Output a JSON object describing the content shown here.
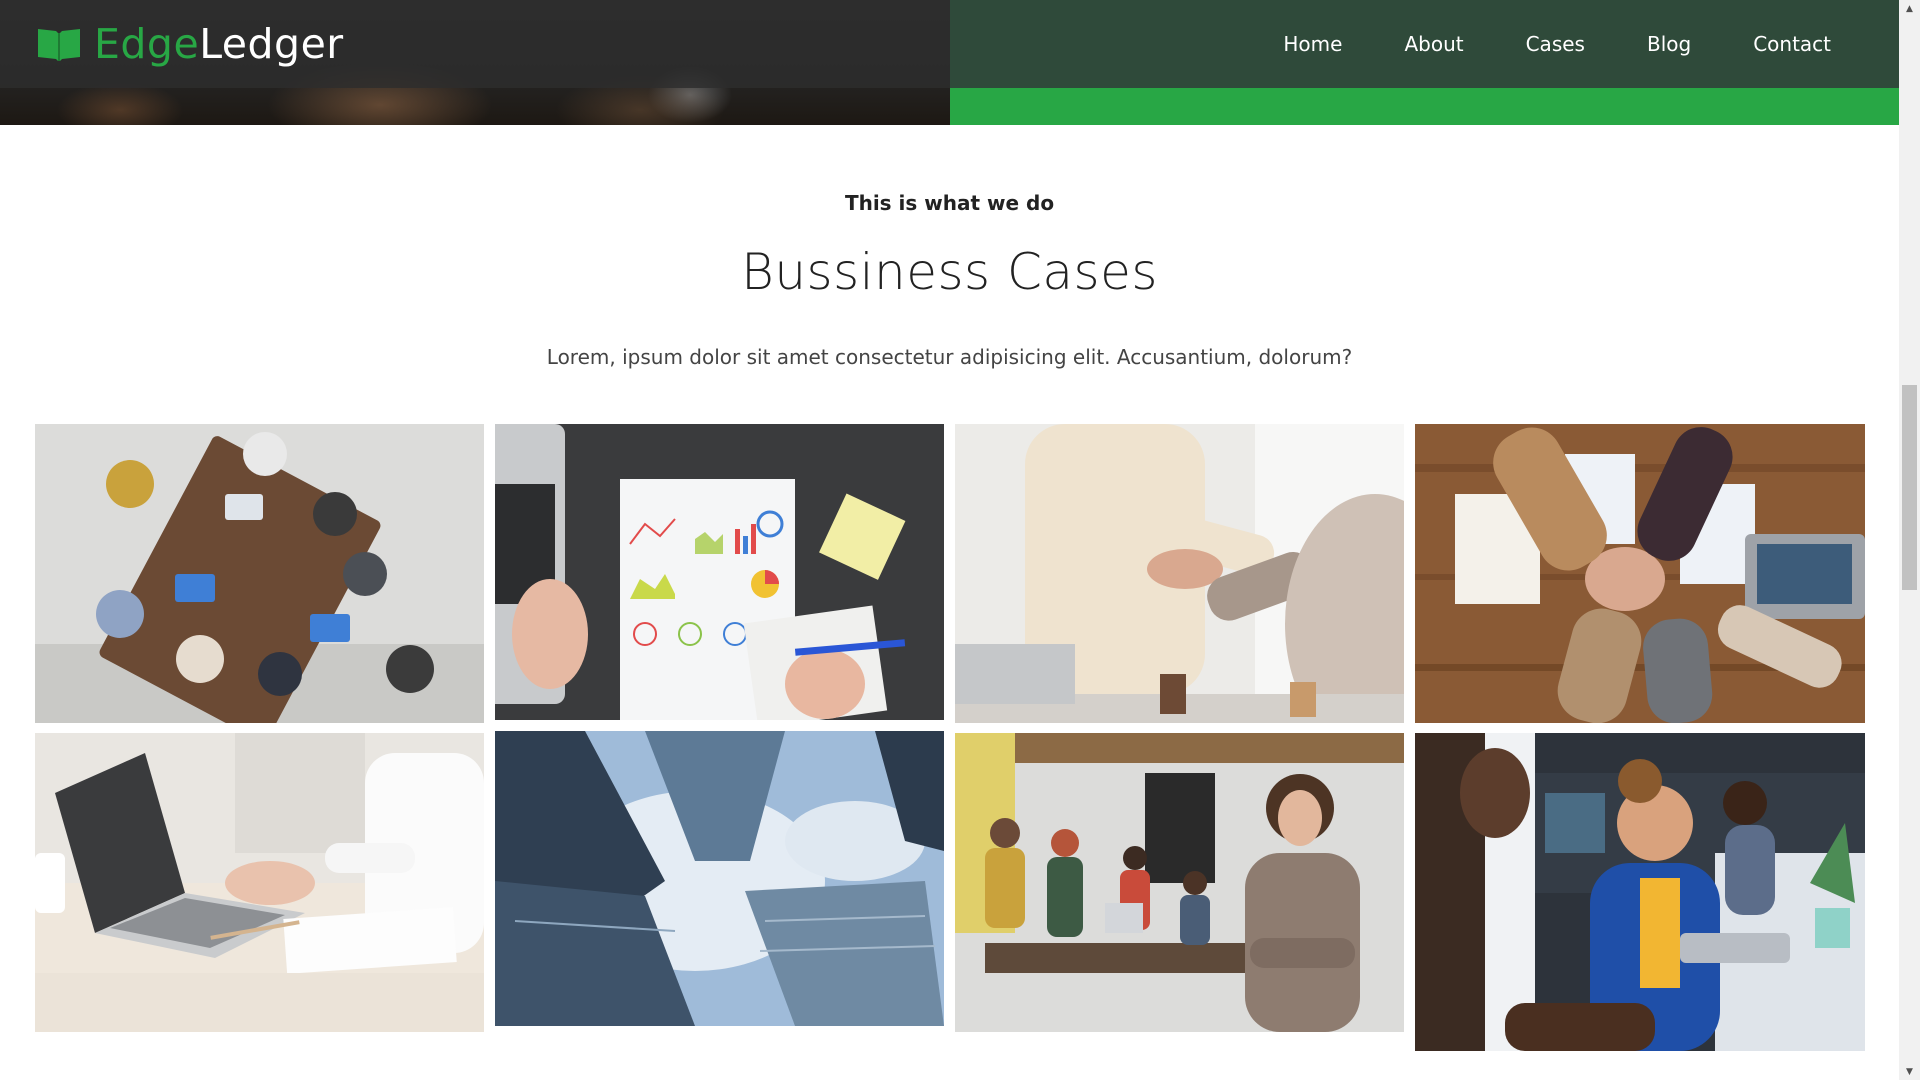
{
  "brand": {
    "part1": "Edge",
    "part2": "Ledger",
    "icon": "open-book-icon",
    "accent_color": "#28a745",
    "nav_bg": "#2f4a3a"
  },
  "nav": {
    "items": [
      "Home",
      "About",
      "Cases",
      "Blog",
      "Contact"
    ]
  },
  "cases_section": {
    "eyebrow": "This is what we do",
    "title": "Bussiness Cases",
    "lead": "Lorem, ipsum dolor sit amet consectetur adipisicing elit. Accusantium, dolorum?"
  },
  "gallery": {
    "photos": [
      "team-meeting-overhead-photo",
      "charts-and-laptop-desk-photo",
      "business-handshake-photo",
      "team-hands-stacked-photo",
      "laptop-typing-photo",
      "skyscrapers-from-below-photo",
      "office-team-portrait-photo",
      "smiling-coworkers-office-photo"
    ]
  },
  "scrollbar": {
    "up_icon": "arrow-up-icon",
    "down_icon": "arrow-down-icon"
  }
}
